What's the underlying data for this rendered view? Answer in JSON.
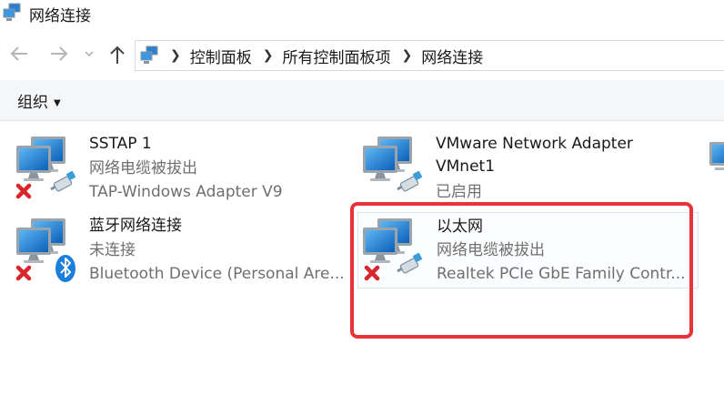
{
  "window": {
    "title": "网络连接",
    "icon": "network-connections-icon"
  },
  "nav": {
    "back_icon": "back-arrow-icon",
    "forward_icon": "forward-arrow-icon",
    "history_icon": "chevron-down-icon",
    "up_icon": "up-arrow-icon"
  },
  "breadcrumb": [
    "控制面板",
    "所有控制面板项",
    "网络连接"
  ],
  "command_bar": {
    "organize_label": "组织"
  },
  "connections": [
    {
      "name": "SSTAP 1",
      "status": "网络电缆被拔出",
      "device": "TAP-Windows Adapter V9",
      "badge": "disabled-x"
    },
    {
      "name": "VMware Network Adapter",
      "name2": "VMnet1",
      "status": "已启用",
      "device": "",
      "badge": "none"
    },
    {
      "name": "蓝牙网络连接",
      "status": "未连接",
      "device": "Bluetooth Device (Personal Are...",
      "badge": "bluetooth"
    },
    {
      "name": "以太网",
      "status": "网络电缆被拔出",
      "device": "Realtek PCIe GbE Family Contr...",
      "badge": "disabled-x"
    }
  ],
  "colors": {
    "highlight_box": "#e8333b",
    "monitor_blue": "#1f7fd6",
    "selection_border": "#d9e6f2"
  }
}
